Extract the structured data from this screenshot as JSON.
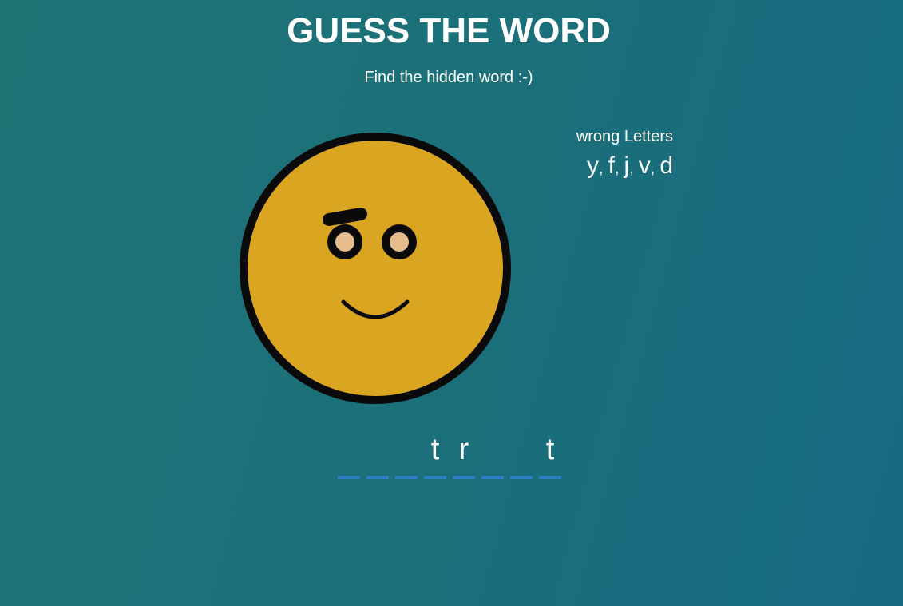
{
  "header": {
    "title": "GUESS THE WORD",
    "subtitle": "Find the hidden word :-)"
  },
  "wrong_letters": {
    "label": "wrong Letters",
    "letters": [
      "y",
      "f",
      "j",
      "v",
      "d"
    ],
    "display": "y, f, j, v, d"
  },
  "word": {
    "slots": [
      "",
      "",
      "",
      "t",
      "r",
      "",
      "",
      "t"
    ]
  },
  "colors": {
    "face_fill": "#daa520",
    "face_outline": "#0a0a0a",
    "pupil": "#e6bc8c",
    "dash": "#2f7fc6"
  }
}
